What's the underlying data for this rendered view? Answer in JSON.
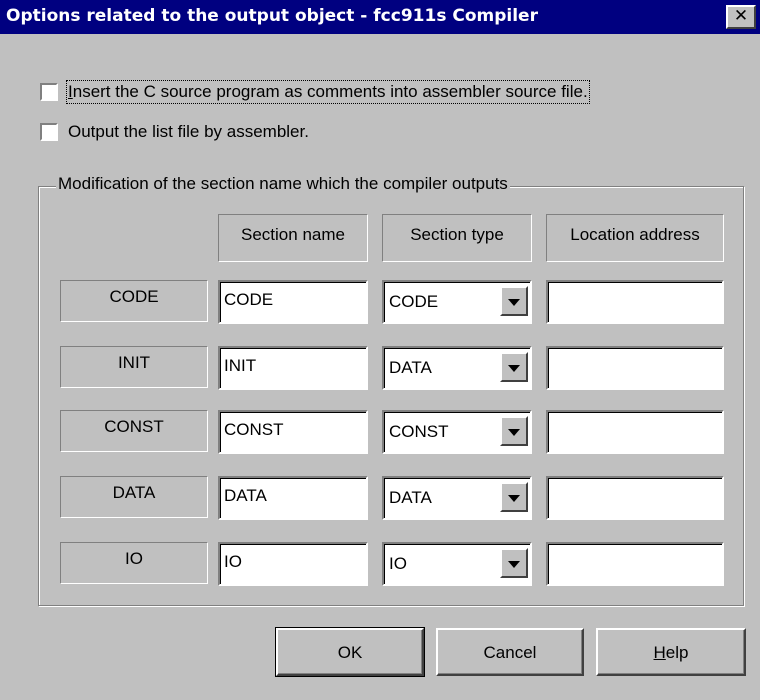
{
  "window": {
    "title": "Options related to the output object - fcc911s Compiler",
    "close_glyph": "✕"
  },
  "options": {
    "insert_c_source": {
      "checked": false,
      "label_first_char": "I",
      "label_rest": "nsert the C source program as comments into assembler source file."
    },
    "output_list_file": {
      "checked": false,
      "label": "Output the list file by assembler."
    }
  },
  "section_group": {
    "title": "Modification of the section name which the compiler outputs",
    "headers": {
      "name": "Section name",
      "type": "Section type",
      "address": "Location address"
    },
    "rows": [
      {
        "label": "CODE",
        "name": "CODE",
        "type": "CODE",
        "address": ""
      },
      {
        "label": "INIT",
        "name": "INIT",
        "type": "DATA",
        "address": ""
      },
      {
        "label": "CONST",
        "name": "CONST",
        "type": "CONST",
        "address": ""
      },
      {
        "label": "DATA",
        "name": "DATA",
        "type": "DATA",
        "address": ""
      },
      {
        "label": "IO",
        "name": "IO",
        "type": "IO",
        "address": ""
      }
    ]
  },
  "buttons": {
    "ok": "OK",
    "cancel": "Cancel",
    "help_mnemonic": "H",
    "help_rest": "elp"
  },
  "colors": {
    "dialog_face": "#c0c0c0",
    "titlebar": "#000080"
  }
}
